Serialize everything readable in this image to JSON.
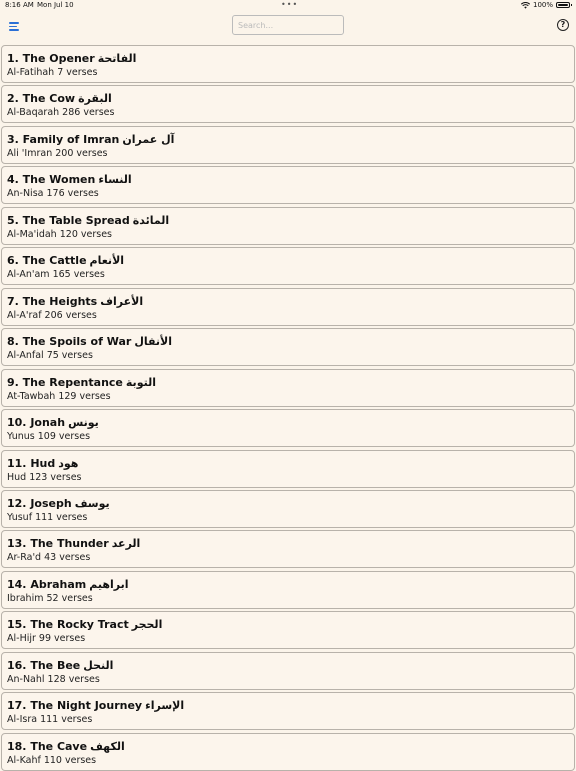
{
  "status": {
    "time": "8:16 AM",
    "date": "Mon Jul 10",
    "battery": "100%",
    "wifi_icon": "wifi-icon",
    "battery_icon": "battery-icon"
  },
  "toolbar": {
    "menu_icon": "menu-icon",
    "search_placeholder": "Search...",
    "search_value": "",
    "help_label": "?"
  },
  "surahs": [
    {
      "title": "1. The Opener",
      "arabic": "الفاتحة",
      "subtitle": "Al-Fatihah 7 verses"
    },
    {
      "title": "2. The Cow",
      "arabic": "البقرة",
      "subtitle": "Al-Baqarah 286 verses"
    },
    {
      "title": "3. Family of Imran",
      "arabic": "آل عمران",
      "subtitle": "Ali 'Imran 200 verses"
    },
    {
      "title": "4. The Women",
      "arabic": "النساء",
      "subtitle": "An-Nisa 176 verses"
    },
    {
      "title": "5. The Table Spread",
      "arabic": "المائدة",
      "subtitle": "Al-Ma'idah 120 verses"
    },
    {
      "title": "6. The Cattle",
      "arabic": "الأنعام",
      "subtitle": "Al-An'am 165 verses"
    },
    {
      "title": "7. The Heights",
      "arabic": "الأعراف",
      "subtitle": "Al-A'raf 206 verses"
    },
    {
      "title": "8. The Spoils of War",
      "arabic": "الأنفال",
      "subtitle": "Al-Anfal 75 verses"
    },
    {
      "title": "9. The Repentance",
      "arabic": "التوبة",
      "subtitle": "At-Tawbah 129 verses"
    },
    {
      "title": "10. Jonah",
      "arabic": "يونس",
      "subtitle": "Yunus 109 verses"
    },
    {
      "title": "11. Hud",
      "arabic": "هود",
      "subtitle": "Hud 123 verses"
    },
    {
      "title": "12. Joseph",
      "arabic": "يوسف",
      "subtitle": "Yusuf 111 verses"
    },
    {
      "title": "13. The Thunder",
      "arabic": "الرعد",
      "subtitle": "Ar-Ra'd 43 verses"
    },
    {
      "title": "14. Abraham",
      "arabic": "ابراهيم",
      "subtitle": "Ibrahim 52 verses"
    },
    {
      "title": "15. The Rocky Tract",
      "arabic": "الحجر",
      "subtitle": "Al-Hijr 99 verses"
    },
    {
      "title": "16. The Bee",
      "arabic": "النحل",
      "subtitle": "An-Nahl 128 verses"
    },
    {
      "title": "17. The Night Journey",
      "arabic": "الإسراء",
      "subtitle": "Al-Isra 111 verses"
    },
    {
      "title": "18. The Cave",
      "arabic": "الكهف",
      "subtitle": "Al-Kahf 110 verses"
    }
  ]
}
